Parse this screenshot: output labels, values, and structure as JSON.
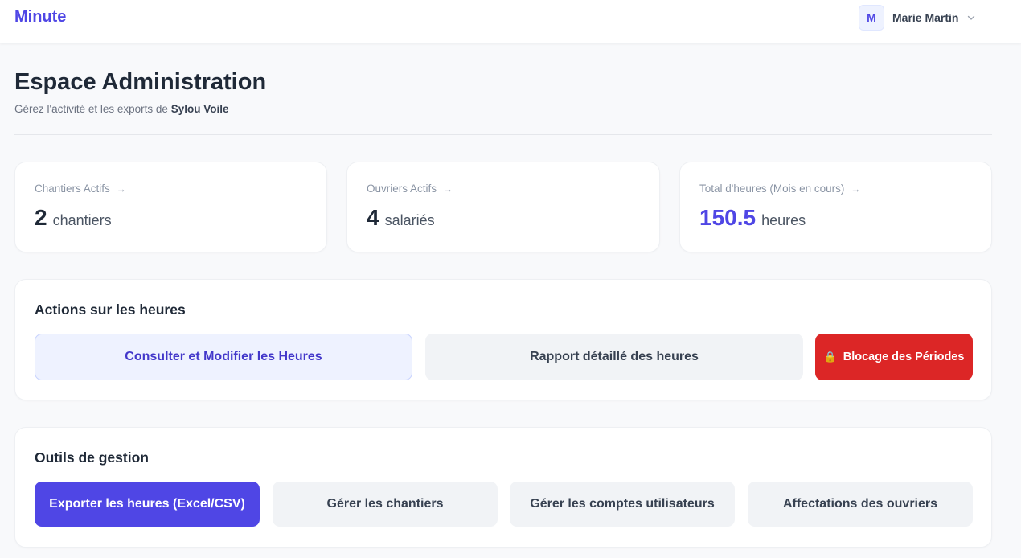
{
  "header": {
    "brand": "Minute",
    "user": {
      "initial": "M",
      "name": "Marie Martin"
    }
  },
  "page": {
    "title": "Espace Administration",
    "subtitle_prefix": "Gérez l'activité et les exports de",
    "company": "Sylou Voile"
  },
  "stats": [
    {
      "label": "Chantiers Actifs",
      "arrow": "→",
      "value": "2",
      "unit": "chantiers"
    },
    {
      "label": "Ouvriers Actifs",
      "arrow": "→",
      "value": "4",
      "unit": "salariés"
    },
    {
      "label": "Total d'heures (Mois en cours)",
      "arrow": "→",
      "value": "150.5",
      "unit": "heures"
    }
  ],
  "hours_actions": {
    "title": "Actions sur les heures",
    "consult_label": "Consulter et Modifier les Heures",
    "report_label": "Rapport détaillé des heures",
    "lock_icon": "🔒",
    "lock_label": "Blocage des Périodes"
  },
  "management_tools": {
    "title": "Outils de gestion",
    "export_label": "Exporter les heures (Excel/CSV)",
    "sites_label": "Gérer les chantiers",
    "accounts_label": "Gérer les comptes utilisateurs",
    "assignments_label": "Affectations des ouvriers"
  },
  "colors": {
    "brand": "#4f46e5",
    "danger": "#dc2626",
    "light_indigo_bg": "#eef2ff",
    "neutral_button_bg": "#f1f3f6"
  }
}
